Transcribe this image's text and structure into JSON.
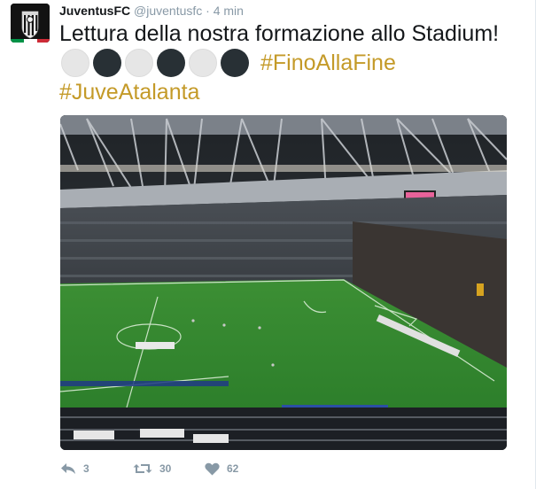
{
  "author": {
    "display_name": "JuventusFC",
    "handle": "@juventusfc",
    "separator": "·",
    "time": "4 min"
  },
  "tweet": {
    "text": "Lettura della nostra formazione allo Stadium!",
    "emoji_sequence": [
      "white",
      "black",
      "white",
      "black",
      "white",
      "black"
    ],
    "hashtags": [
      "#FinoAllaFine",
      "#JuveAtalanta"
    ]
  },
  "actions": {
    "reply_count": "3",
    "retweet_count": "30",
    "like_count": "62"
  },
  "colors": {
    "hashtag": "#c49a28",
    "muted": "#8899a6",
    "text": "#14171a",
    "pitch": "#2f8a2f"
  },
  "icons": {
    "avatar": "juventus-logo-icon",
    "reply": "reply-icon",
    "retweet": "retweet-icon",
    "like": "heart-icon"
  }
}
